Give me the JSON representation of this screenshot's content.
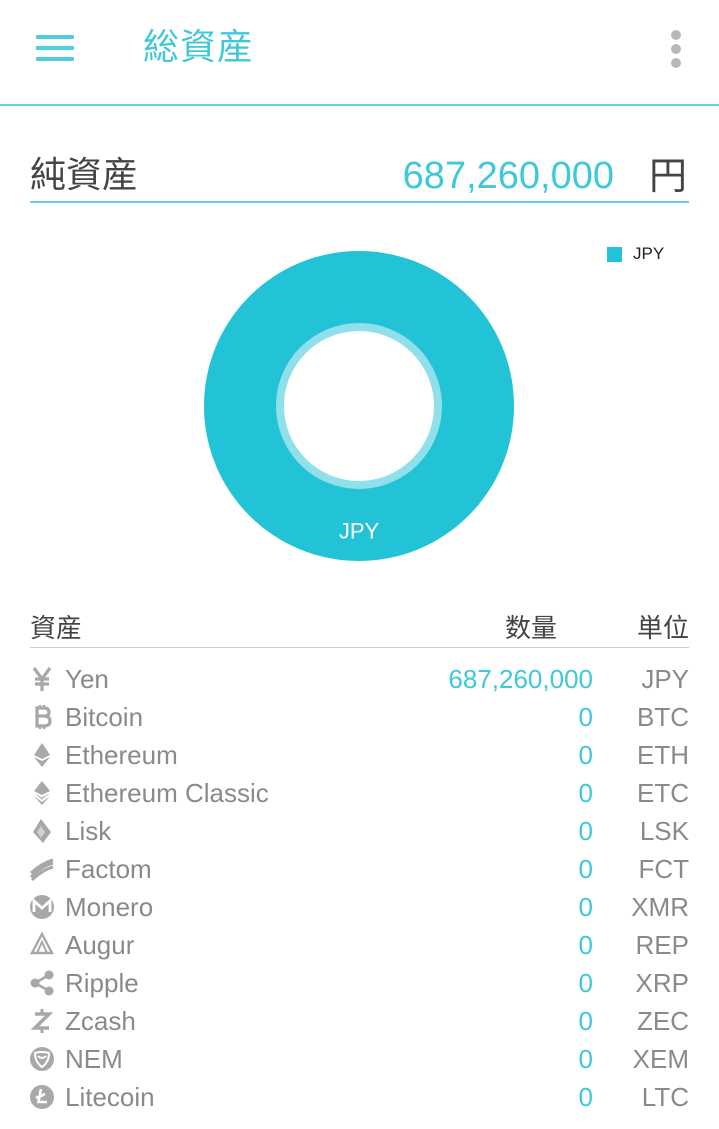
{
  "appbar": {
    "title": "総資産",
    "menu_icon": "hamburger-menu-icon",
    "more_icon": "more-vertical-icon"
  },
  "net_assets": {
    "label": "純資産",
    "value": "687,260,000",
    "unit": "円"
  },
  "chart_data": {
    "type": "pie",
    "donut": true,
    "categories": [
      "JPY"
    ],
    "values": [
      687260000
    ],
    "slice_labels": [
      "JPY"
    ],
    "legend": [
      "JPY"
    ],
    "legend_position": "top-right",
    "colors": [
      "#22c3d6"
    ]
  },
  "table": {
    "headers": {
      "asset": "資産",
      "quantity": "数量",
      "unit": "単位"
    },
    "rows": [
      {
        "icon": "yen-icon",
        "name": "Yen",
        "quantity": "687,260,000",
        "unit": "JPY"
      },
      {
        "icon": "bitcoin-icon",
        "name": "Bitcoin",
        "quantity": "0",
        "unit": "BTC"
      },
      {
        "icon": "ethereum-icon",
        "name": "Ethereum",
        "quantity": "0",
        "unit": "ETH"
      },
      {
        "icon": "ethereum-classic-icon",
        "name": "Ethereum Classic",
        "quantity": "0",
        "unit": "ETC"
      },
      {
        "icon": "lisk-icon",
        "name": "Lisk",
        "quantity": "0",
        "unit": "LSK"
      },
      {
        "icon": "factom-icon",
        "name": "Factom",
        "quantity": "0",
        "unit": "FCT"
      },
      {
        "icon": "monero-icon",
        "name": "Monero",
        "quantity": "0",
        "unit": "XMR"
      },
      {
        "icon": "augur-icon",
        "name": "Augur",
        "quantity": "0",
        "unit": "REP"
      },
      {
        "icon": "ripple-icon",
        "name": "Ripple",
        "quantity": "0",
        "unit": "XRP"
      },
      {
        "icon": "zcash-icon",
        "name": "Zcash",
        "quantity": "0",
        "unit": "ZEC"
      },
      {
        "icon": "nem-icon",
        "name": "NEM",
        "quantity": "0",
        "unit": "XEM"
      },
      {
        "icon": "litecoin-icon",
        "name": "Litecoin",
        "quantity": "0",
        "unit": "LTC"
      }
    ]
  },
  "colors": {
    "accent": "#3fc8d8",
    "chart": "#22c3d6",
    "muted_text": "#8a8a8a",
    "icon": "#a8a8a8"
  }
}
